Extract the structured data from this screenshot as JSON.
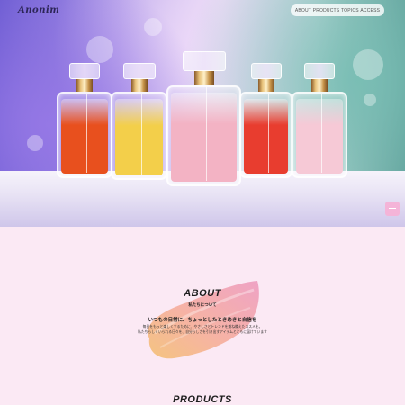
{
  "header": {
    "logo": "Anonim",
    "nav": [
      {
        "label": "ABOUT"
      },
      {
        "label": "PRODUCTS"
      },
      {
        "label": "TOPICS"
      },
      {
        "label": "ACCESS"
      }
    ]
  },
  "hero": {
    "bottles": [
      {
        "liquid_color": "#e8501e"
      },
      {
        "liquid_color": "#f3cf4a"
      },
      {
        "liquid_color": "#f3b3c4"
      },
      {
        "liquid_color": "#e83d2f"
      },
      {
        "liquid_color": "#f6c9d6"
      }
    ]
  },
  "about": {
    "title": "ABOUT",
    "subtitle": "私たちについて",
    "lead": "いつもの日常に、ちょっとしたときめきと自信を",
    "body": [
      "毎日をもっと楽しくするために、やさしさとトレンドを兼ね備えたコスメを。",
      "私たちらしくいられる日々を、自分らしさを引き出すアイテムとともに届けています"
    ]
  },
  "products": {
    "title": "PRODUCTS"
  },
  "colors": {
    "page_bg": "#fbe9f4",
    "accent_pink": "#f4b4d8"
  }
}
